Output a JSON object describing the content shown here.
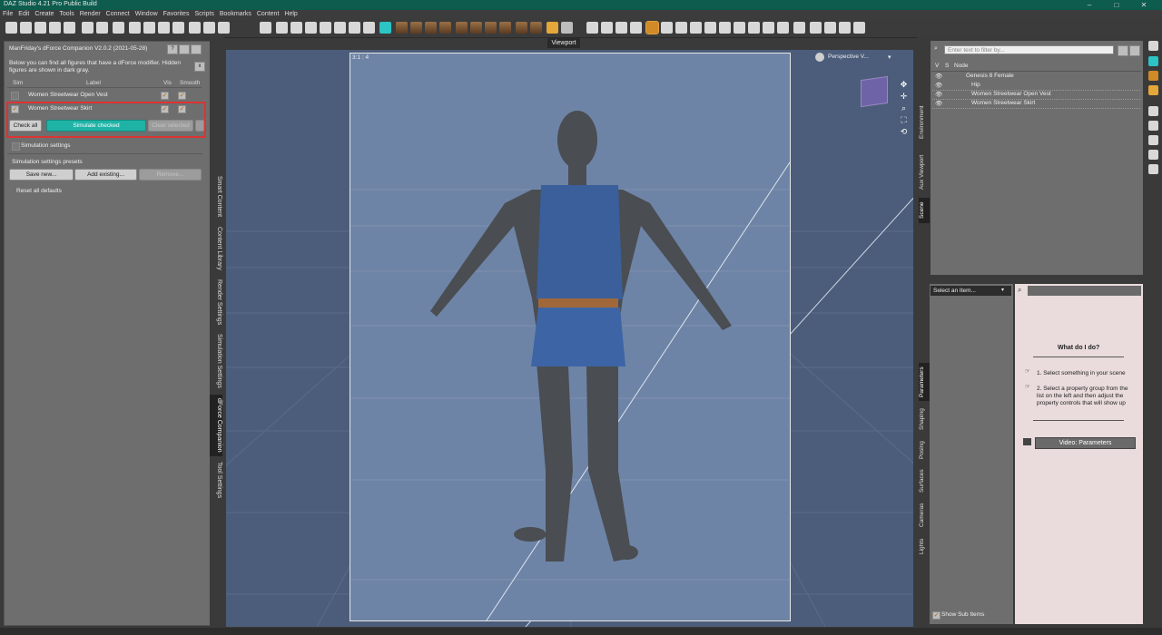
{
  "window": {
    "title": "DAZ Studio 4.21 Pro Public Build"
  },
  "menu": [
    "File",
    "Edit",
    "Create",
    "Tools",
    "Render",
    "Connect",
    "Window",
    "Favorites",
    "Scripts",
    "Bookmarks",
    "Content",
    "Help"
  ],
  "toolbar_tooltip": "Viewport",
  "dforce": {
    "title": "ManFriday's dForce Companion V2.0.2 (2021-05-28)",
    "help_label": "?",
    "close_label": "x",
    "description": "Below you can find all figures that have a dForce modifier. Hidden figures are shown in dark gray.",
    "headers": {
      "sim": "Sim",
      "label": "Label",
      "vis": "Vis",
      "smooth": "Smooth"
    },
    "rows": [
      {
        "label": "Women Streetwear Open Vest",
        "sim": false,
        "vis": true,
        "smooth": true
      },
      {
        "label": "Women Streetwear Skirt",
        "sim": true,
        "vis": true,
        "smooth": true
      }
    ],
    "check_all": "Check all",
    "simulate_checked": "Simulate checked",
    "clear_selected": "Clear selected",
    "simulation_settings": "Simulation settings",
    "presets_title": "Simulation settings presets",
    "save_new": "Save new...",
    "add_existing": "Add existing...",
    "remove": "Remove...",
    "reset_defaults": "Reset all defaults"
  },
  "left_tabs": [
    "Smart Content",
    "Content Library",
    "Render Settings",
    "Simulation Settings",
    "dForce Companion",
    "Tool Settings"
  ],
  "left_tab_active": "dForce Companion",
  "viewport": {
    "tab": "Viewport",
    "aspect": "3:1 : 4",
    "camera": "Perspective V..."
  },
  "scene": {
    "search_placeholder": "Enter text to filter by...",
    "headers": {
      "v": "V",
      "s": "S",
      "node": "Node"
    },
    "nodes": [
      "Genesis 8 Female",
      "Hip",
      "Women Streetwear Open Vest",
      "Women Streetwear Skirt"
    ],
    "tabs": [
      "Environment",
      "Aux Viewport",
      "Scene"
    ],
    "active_tab": "Scene"
  },
  "parameters": {
    "select_item": "Select an Item...",
    "help_title": "What do I do?",
    "step1": "1. Select something in your scene",
    "step2": "2. Select a property group from the list on the left and then adjust the property controls that will show up",
    "video_button": "Video: Parameters",
    "show_sub_items": "Show Sub Items",
    "tabs": [
      "Parameters",
      "Shaping",
      "Posing",
      "Surfaces",
      "Cameras",
      "Lights"
    ],
    "active_tab": "Parameters"
  },
  "colors": {
    "titlebar": "#0d5c4e",
    "accent_teal": "#1fb3a6",
    "highlight_red": "#dd3333",
    "viewport_bg": "#4b5d7a"
  }
}
